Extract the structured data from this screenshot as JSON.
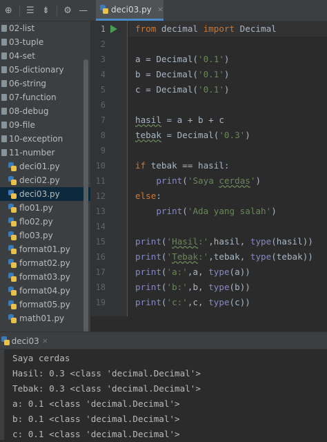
{
  "project_tree": {
    "folders": [
      "02-list",
      "03-tuple",
      "04-set",
      "05-dictionary",
      "06-string",
      "07-function",
      "08-debug",
      "09-file",
      "10-exception",
      "11-number"
    ],
    "files": [
      "deci01.py",
      "deci02.py",
      "deci03.py",
      "flo01.py",
      "flo02.py",
      "flo03.py",
      "format01.py",
      "format02.py",
      "format03.py",
      "format04.py",
      "format05.py",
      "math01.py"
    ],
    "selected_file": "deci03.py"
  },
  "editor": {
    "tab_title": "deci03.py",
    "tab_close": "×",
    "line_numbers": [
      "1",
      "2",
      "3",
      "4",
      "5",
      "6",
      "7",
      "8",
      "9",
      "10",
      "11",
      "12",
      "13",
      "14",
      "15",
      "16",
      "17",
      "18",
      "19"
    ]
  },
  "run_panel": {
    "tab_title": "deci03",
    "tab_close": "×",
    "output": [
      "Saya cerdas",
      "Hasil: 0.3 <class 'decimal.Decimal'>",
      "Tebak: 0.3 <class 'decimal.Decimal'>",
      "a: 0.1 <class 'decimal.Decimal'>",
      "b: 0.1 <class 'decimal.Decimal'>",
      "c: 0.1 <class 'decimal.Decimal'>"
    ]
  },
  "colors": {
    "keyword": "#cc7832",
    "string": "#6a8759",
    "builtin": "#8888c6",
    "selection": "#0d293e",
    "run_icon": "#499c54"
  },
  "icons": [
    "add-icon",
    "expand-all-icon",
    "collapse-all-icon",
    "gear-icon",
    "minimize-icon",
    "python-file-icon",
    "run-icon",
    "folder-icon"
  ]
}
